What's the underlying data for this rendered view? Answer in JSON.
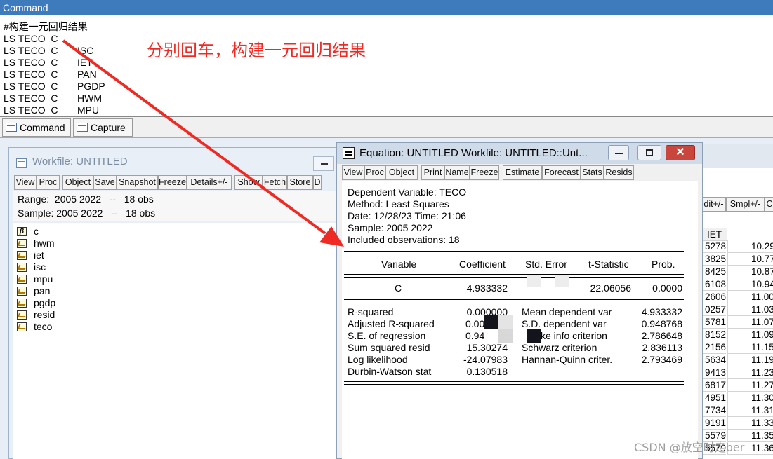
{
  "command_window": {
    "title": "Command",
    "lines": [
      {
        "a": "#构建一元回归结果",
        "b": ""
      },
      {
        "a": "LS TECO  C",
        "b": ""
      },
      {
        "a": "LS TECO  C",
        "b": "ISC"
      },
      {
        "a": "LS TECO  C",
        "b": "IET"
      },
      {
        "a": "LS TECO  C",
        "b": "PAN"
      },
      {
        "a": "LS TECO  C",
        "b": "PGDP"
      },
      {
        "a": "LS TECO  C",
        "b": "HWM"
      },
      {
        "a": "LS TECO  C",
        "b": "MPU"
      }
    ],
    "annotation": "分别回车，构建一元回归结果",
    "tabs": [
      {
        "label": "Command",
        "icon": "command-tab-icon"
      },
      {
        "label": "Capture",
        "icon": "capture-tab-icon"
      }
    ]
  },
  "workfile_window": {
    "title": "Workfile: UNTITLED",
    "toolbar": [
      "View",
      "Proc",
      "Object",
      "Save",
      "Snapshot",
      "Freeze",
      "Details+/-",
      "Show",
      "Fetch",
      "Store",
      "D"
    ],
    "range_label": "Range:  2005 2022   --   18 obs",
    "sample_label": "Sample: 2005 2022   --   18 obs",
    "objects": [
      {
        "name": "c",
        "type": "coefficient"
      },
      {
        "name": "hwm",
        "type": "series"
      },
      {
        "name": "iet",
        "type": "series"
      },
      {
        "name": "isc",
        "type": "series"
      },
      {
        "name": "mpu",
        "type": "series"
      },
      {
        "name": "pan",
        "type": "series"
      },
      {
        "name": "pgdp",
        "type": "series"
      },
      {
        "name": "resid",
        "type": "series"
      },
      {
        "name": "teco",
        "type": "series"
      }
    ]
  },
  "background_table": {
    "toolbar": [
      "dit+/-",
      "Smpl+/-",
      "C"
    ],
    "header": "IET",
    "col1": [
      "5278",
      "3825",
      "8425",
      "6108",
      "2606",
      "0257",
      "5781",
      "8152",
      "2156",
      "5634",
      "9413",
      "6817",
      "4951",
      "7734",
      "9191",
      "5579",
      "5579"
    ],
    "col2": [
      "10.29",
      "10.77",
      "10.87",
      "10.94",
      "11.00",
      "11.03",
      "11.07",
      "11.09",
      "11.15",
      "11.19",
      "11.23",
      "11.27",
      "11.30",
      "11.31",
      "11.33",
      "11.35",
      "11.36"
    ]
  },
  "equation_window": {
    "title": "Equation: UNTITLED   Workfile: UNTITLED::Unt...",
    "toolbar": [
      "View",
      "Proc",
      "Object",
      "Print",
      "Name",
      "Freeze",
      "Estimate",
      "Forecast",
      "Stats",
      "Resids"
    ],
    "header_lines": [
      "Dependent Variable: TECO",
      "Method: Least Squares",
      "Date: 12/28/23   Time: 21:06",
      "Sample: 2005 2022",
      "Included observations: 18"
    ],
    "table_headers": [
      "Variable",
      "Coefficient",
      "Std. Error",
      "t-Statistic",
      "Prob."
    ],
    "row": {
      "variable": "C",
      "coefficient": "4.933332",
      "std_error": "",
      "t_statistic": "22.06056",
      "prob": "0.0000"
    },
    "stats_left": [
      {
        "label": "R-squared",
        "value": "0.000000"
      },
      {
        "label": "Adjusted R-squared",
        "value": "0.00"
      },
      {
        "label": "S.E. of regression",
        "value": "0.94"
      },
      {
        "label": "Sum squared resid",
        "value": "15.30274"
      },
      {
        "label": "Log likelihood",
        "value": "-24.07983"
      },
      {
        "label": "Durbin-Watson stat",
        "value": "0.130518"
      }
    ],
    "stats_right": [
      {
        "label": "Mean dependent var",
        "value": "4.933332"
      },
      {
        "label": "S.D. dependent var",
        "value": "0.948768"
      },
      {
        "label": "ke info criterion",
        "value": "2.786648"
      },
      {
        "label": "Schwarz criterion",
        "value": "2.836113"
      },
      {
        "label": "Hannan-Quinn criter.",
        "value": "2.793469"
      }
    ]
  },
  "watermark": "CSDN @放空时走ber",
  "colors": {
    "annotation": "#ee2a24",
    "titlebar": "#3d7bbd"
  }
}
